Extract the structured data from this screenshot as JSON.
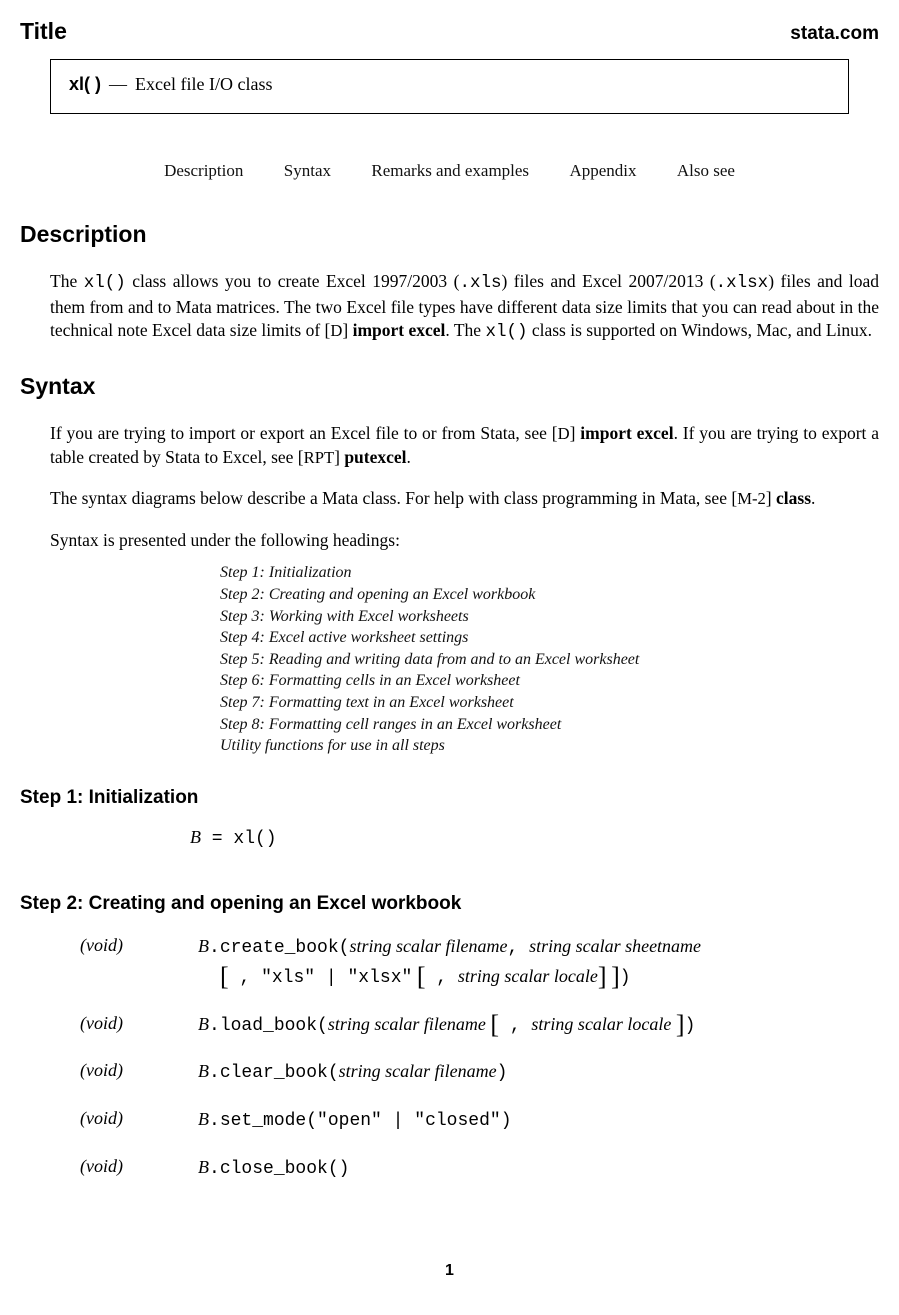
{
  "header": {
    "title_label": "Title",
    "site": "stata.com"
  },
  "title_box": {
    "fn": "xl( )",
    "dash": "—",
    "desc": "Excel file I/O class"
  },
  "nav": {
    "description": "Description",
    "syntax": "Syntax",
    "remarks": "Remarks and examples",
    "appendix": "Appendix",
    "also_see": "Also see"
  },
  "sections": {
    "description_h": "Description",
    "syntax_h": "Syntax",
    "step1_h": "Step 1: Initialization",
    "step2_h": "Step 2: Creating and opening an Excel workbook"
  },
  "desc_para": {
    "t1": "The ",
    "code1": "xl()",
    "t2": " class allows you to create Excel 1997/2003 (",
    "code2": ".xls",
    "t3": ") files and Excel 2007/2013 (",
    "code3": ".xlsx",
    "t4": ") files and load them from and to Mata matrices. The two Excel file types have different data size limits that you can read about in the technical note Excel data size limits of [",
    "ref1": "D",
    "t5": "] ",
    "bold1": "import excel",
    "t6": ". The ",
    "code4": "xl()",
    "t7": " class is supported on Windows, Mac, and Linux."
  },
  "syntax_p1": {
    "t1": "If you are trying to import or export an Excel file to or from Stata, see [",
    "ref1": "D",
    "t2": "] ",
    "bold1": "import excel",
    "t3": ". If you are trying to export a table created by Stata to Excel, see [",
    "ref2": "RPT",
    "t4": "] ",
    "bold2": "putexcel",
    "t5": "."
  },
  "syntax_p2": {
    "t1": "The syntax diagrams below describe a Mata class. For help with class programming in Mata, see [",
    "ref1": "M-2",
    "t2": "] ",
    "bold1": "class",
    "t3": "."
  },
  "syntax_p3": "Syntax is presented under the following headings:",
  "toc": [
    "Step 1: Initialization",
    "Step 2: Creating and opening an Excel workbook",
    "Step 3: Working with Excel worksheets",
    "Step 4: Excel active worksheet settings",
    "Step 5: Reading and writing data from and to an Excel worksheet",
    "Step 6: Formatting cells in an Excel worksheet",
    "Step 7: Formatting text in an Excel worksheet",
    "Step 8: Formatting cell ranges in an Excel worksheet",
    "Utility functions for use in all steps"
  ],
  "init": {
    "B": "B",
    "eq": " = ",
    "xl": "xl()"
  },
  "funcs": {
    "void": "(void)",
    "B": "B",
    "dot": ".",
    "create_book": "create_book",
    "load_book": "load_book",
    "clear_book": "clear_book",
    "set_mode": "set_mode",
    "close_book": "close_book",
    "arg_filename": "string scalar filename",
    "arg_sheetname": "string scalar sheetname",
    "arg_locale": "string scalar locale",
    "lit_xls": "\"xls\"",
    "lit_xlsx": "\"xlsx\"",
    "lit_open": "\"open\"",
    "lit_closed": "\"closed\""
  },
  "page_number": "1"
}
